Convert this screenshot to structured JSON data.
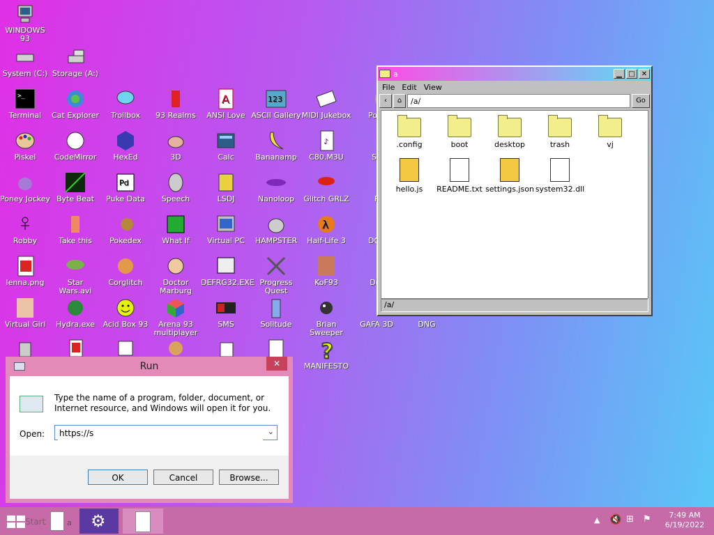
{
  "desktop": {
    "icons": [
      {
        "label": "WINDOWS 93",
        "icon": "computer-icon"
      },
      {
        "label": "System (C:)",
        "icon": "drive-icon"
      },
      {
        "label": "Storage (A:)",
        "icon": "floppy-icon"
      },
      {
        "label": "Terminal",
        "icon": "terminal-icon"
      },
      {
        "label": "Cat Explorer",
        "icon": "cat-explorer-icon"
      },
      {
        "label": "Trollbox",
        "icon": "chat-icon"
      },
      {
        "label": "93 Realms",
        "icon": "realms-icon"
      },
      {
        "label": "ANSI Love",
        "icon": "ansi-icon"
      },
      {
        "label": "ASCII Gallery",
        "icon": "ascii-icon"
      },
      {
        "label": "MIDI Jukebox",
        "icon": "piano-icon"
      },
      {
        "label": "Pota",
        "icon": "potato-icon"
      },
      {
        "label": "Piskel",
        "icon": "palette-icon"
      },
      {
        "label": "CodeMirror",
        "icon": "codemirror-icon"
      },
      {
        "label": "HexEd",
        "icon": "hex-icon"
      },
      {
        "label": "3D",
        "icon": "teapot-icon"
      },
      {
        "label": "Calc",
        "icon": "calculator-icon"
      },
      {
        "label": "Bananamp",
        "icon": "banana-icon"
      },
      {
        "label": "C80.M3U",
        "icon": "playlist-icon"
      },
      {
        "label": "Sa",
        "icon": "ball-icon"
      },
      {
        "label": "Poney Jockey",
        "icon": "pony-icon"
      },
      {
        "label": "Byte Beat",
        "icon": "bytebeat-icon"
      },
      {
        "label": "Puke Data",
        "icon": "pd-icon"
      },
      {
        "label": "Speech",
        "icon": "speech-icon"
      },
      {
        "label": "LSDJ",
        "icon": "lsdj-icon"
      },
      {
        "label": "Nanoloop",
        "icon": "nanoloop-icon"
      },
      {
        "label": "Glitch GRLZ",
        "icon": "lips-icon"
      },
      {
        "label": "F",
        "icon": "f-icon"
      },
      {
        "label": "Robby",
        "icon": "robot-icon"
      },
      {
        "label": "Take this",
        "icon": "take-this-icon"
      },
      {
        "label": "Pokedex",
        "icon": "pokedex-icon"
      },
      {
        "label": "What If",
        "icon": "what-if-icon"
      },
      {
        "label": "Virtual PC",
        "icon": "virtual-pc-icon"
      },
      {
        "label": "HAMPSTER",
        "icon": "hamster-icon"
      },
      {
        "label": "Half-Life 3",
        "icon": "half-life-icon"
      },
      {
        "label": "DOS",
        "icon": "dos-icon"
      },
      {
        "label": "lenna.png",
        "icon": "image-icon"
      },
      {
        "label": "Star Wars.avi",
        "icon": "yoda-icon"
      },
      {
        "label": "Corglitch",
        "icon": "corgi-icon"
      },
      {
        "label": "Doctor Marburg",
        "icon": "doctor-icon"
      },
      {
        "label": "DEFRG32.EXE",
        "icon": "defrag-icon"
      },
      {
        "label": "Progress Quest",
        "icon": "swords-icon"
      },
      {
        "label": "KoF93",
        "icon": "fighter-icon"
      },
      {
        "label": "Det",
        "icon": "det-icon"
      },
      {
        "label": "Virtual Girl",
        "icon": "girl-icon"
      },
      {
        "label": "Hydra.exe",
        "icon": "hydra-icon"
      },
      {
        "label": "Acid Box 93",
        "icon": "smiley-icon"
      },
      {
        "label": "Arena 93 multiplayer",
        "icon": "cube-icon"
      },
      {
        "label": "SMS",
        "icon": "sms-icon"
      },
      {
        "label": "Solitude",
        "icon": "bottle-icon"
      },
      {
        "label": "Brian Sweeper",
        "icon": "mine-icon"
      },
      {
        "label": "GAFA 3D",
        "icon": "gafa-icon"
      },
      {
        "label": "DNG",
        "icon": "dng-icon"
      },
      {
        "label": "MANIFESTO",
        "icon": "question-icon"
      }
    ]
  },
  "explorer": {
    "title": "a",
    "menu": [
      "File",
      "Edit",
      "View"
    ],
    "path": "/a/",
    "go": "Go",
    "status": "/a/",
    "items": [
      {
        "name": ".config",
        "type": "folder"
      },
      {
        "name": "boot",
        "type": "folder"
      },
      {
        "name": "desktop",
        "type": "folder"
      },
      {
        "name": "trash",
        "type": "folder"
      },
      {
        "name": "vj",
        "type": "folder"
      },
      {
        "name": "hello.js",
        "type": "js"
      },
      {
        "name": "README.txt",
        "type": "txt"
      },
      {
        "name": "settings.json",
        "type": "json"
      },
      {
        "name": "system32.dll",
        "type": "dll"
      }
    ]
  },
  "run": {
    "title": "Run",
    "close": "✕",
    "description": "Type the name of a program, folder, document, or Internet resource, and Windows will open it for you.",
    "open_label": "Open:",
    "value": "https://s",
    "ok": "OK",
    "cancel": "Cancel",
    "browse": "Browse..."
  },
  "taskbar": {
    "start_label": "Start",
    "items": [
      "a"
    ],
    "time": "7:49 AM",
    "date": "6/19/2022"
  }
}
